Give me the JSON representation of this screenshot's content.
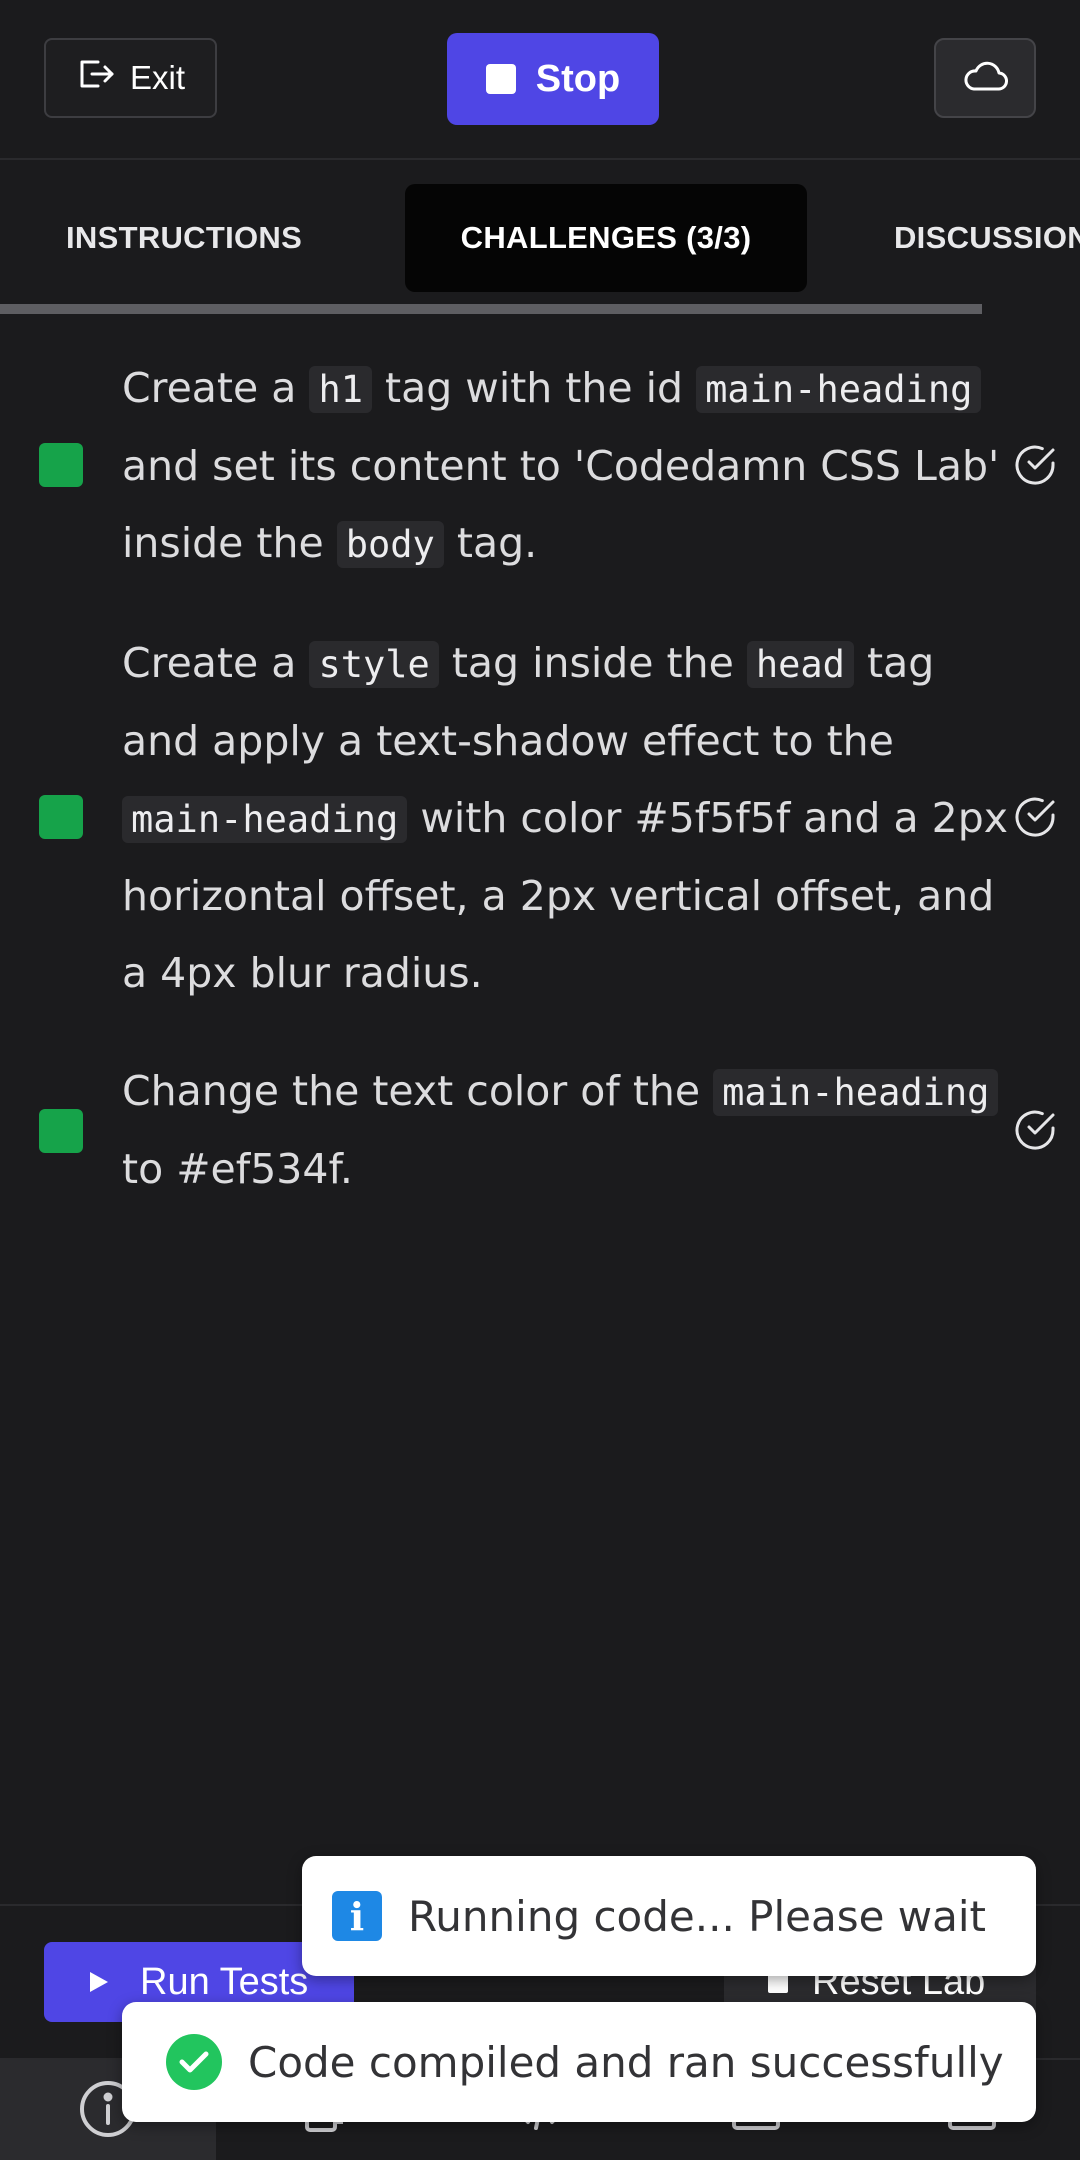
{
  "header": {
    "exit_label": "Exit",
    "stop_label": "Stop"
  },
  "tabs": [
    {
      "label": "INSTRUCTIONS",
      "active": false
    },
    {
      "label": "CHALLENGES (3/3)",
      "active": true
    },
    {
      "label": "DISCUSSION",
      "active": false
    }
  ],
  "challenges": [
    {
      "status": "complete",
      "parts": [
        {
          "t": "Create a "
        },
        {
          "c": "h1"
        },
        {
          "t": " tag with the id "
        },
        {
          "c": "main-heading"
        },
        {
          "t": " and set its content to 'Codedamn CSS Lab' inside the "
        },
        {
          "c": "body"
        },
        {
          "t": " tag."
        }
      ]
    },
    {
      "status": "complete",
      "parts": [
        {
          "t": "Create a "
        },
        {
          "c": "style"
        },
        {
          "t": " tag inside the "
        },
        {
          "c": "head"
        },
        {
          "t": " tag and apply a text-shadow effect to the "
        },
        {
          "c": "main-heading"
        },
        {
          "t": " with color #5f5f5f and a 2px horizontal offset, a 2px vertical offset, and a 4px blur radius."
        }
      ]
    },
    {
      "status": "complete",
      "parts": [
        {
          "t": "Change the text color of the "
        },
        {
          "c": "main-heading"
        },
        {
          "t": " to #ef534f."
        }
      ]
    }
  ],
  "actions": {
    "run_tests_label": "Run Tests",
    "reset_lab_label": "Reset Lab"
  },
  "toasts": {
    "info": "Running code... Please wait",
    "success": "Code compiled and ran successfully"
  },
  "colors": {
    "accent": "#4f46e5",
    "success": "#16a34a",
    "background": "#1b1b1d"
  }
}
